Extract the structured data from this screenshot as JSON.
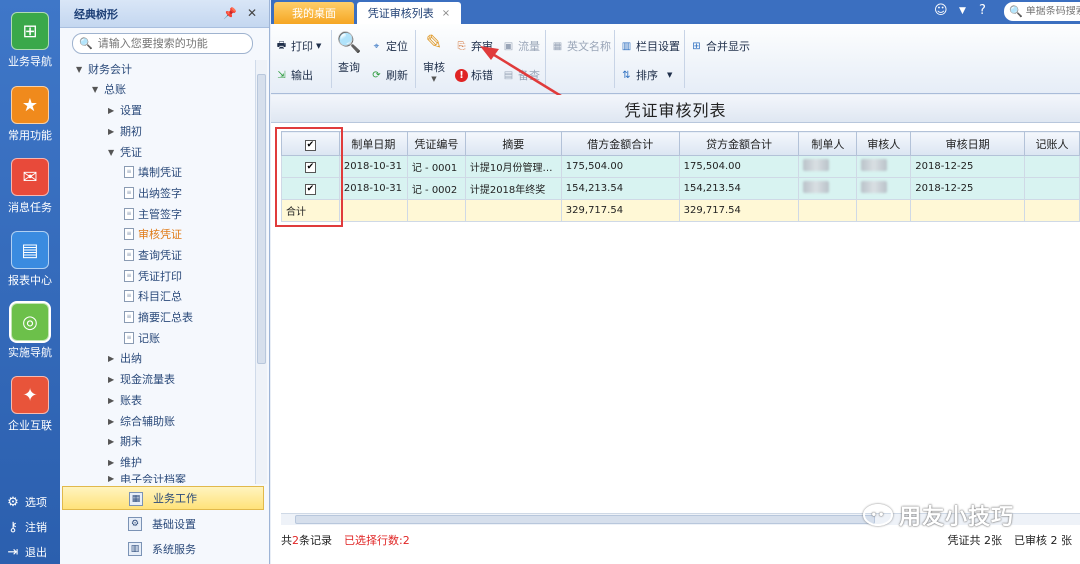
{
  "leftnav": {
    "items": [
      {
        "label": "业务导航",
        "color": "#3aa84a",
        "icon": "flowchart-icon"
      },
      {
        "label": "常用功能",
        "color": "#f08a1c",
        "icon": "star-icon"
      },
      {
        "label": "消息任务",
        "color": "#e84a3a",
        "icon": "envelope-icon"
      },
      {
        "label": "报表中心",
        "color": "#3a8be0",
        "icon": "report-icon"
      },
      {
        "label": "实施导航",
        "color": "#6cc04a",
        "icon": "compass-icon"
      },
      {
        "label": "企业互联",
        "color": "#e8543a",
        "icon": "connect-icon"
      }
    ],
    "bottom": [
      {
        "label": "选项",
        "icon": "gear-icon"
      },
      {
        "label": "注销",
        "icon": "key-icon"
      },
      {
        "label": "退出",
        "icon": "exit-icon"
      }
    ]
  },
  "tree": {
    "title": "经典树形",
    "search_placeholder": "请输入您要搜索的功能",
    "nodes": [
      {
        "label": "财务会计"
      },
      {
        "label": "总账"
      },
      {
        "label": "设置"
      },
      {
        "label": "期初"
      },
      {
        "label": "凭证"
      },
      {
        "label": "填制凭证"
      },
      {
        "label": "出纳签字"
      },
      {
        "label": "主管签字"
      },
      {
        "label": "审核凭证"
      },
      {
        "label": "查询凭证"
      },
      {
        "label": "凭证打印"
      },
      {
        "label": "科目汇总"
      },
      {
        "label": "摘要汇总表"
      },
      {
        "label": "记账"
      },
      {
        "label": "出纳"
      },
      {
        "label": "现金流量表"
      },
      {
        "label": "账表"
      },
      {
        "label": "综合辅助账"
      },
      {
        "label": "期末"
      },
      {
        "label": "维护"
      },
      {
        "label": "电子会计档案"
      }
    ],
    "panels": [
      {
        "label": "业务工作"
      },
      {
        "label": "基础设置"
      },
      {
        "label": "系统服务"
      }
    ]
  },
  "tabs": [
    {
      "label": "我的桌面"
    },
    {
      "label": "凭证审核列表",
      "close": "×"
    }
  ],
  "topbar": {
    "search_placeholder": "单据条码搜索"
  },
  "toolbar": {
    "print": "打印",
    "export": "输出",
    "query": "查询",
    "locate": "定位",
    "refresh": "刷新",
    "audit": "审核",
    "abandon": "弃审",
    "flow": "流量",
    "mark_error": "标错",
    "note": "备查",
    "english_name": "英文名称",
    "column_settings": "栏目设置",
    "sort": "排序",
    "merge_display": "合并显示"
  },
  "content": {
    "title": "凭证审核列表",
    "columns": [
      "✔",
      "制单日期",
      "凭证编号",
      "摘要",
      "借方金额合计",
      "贷方金额合计",
      "制单人",
      "审核人",
      "审核日期",
      "记账人"
    ],
    "rows": [
      {
        "check": "✔",
        "date": "2018-10-31",
        "voucher_no": "记 - 0001",
        "summary": "计提10月份管理…",
        "debit": "175,504.00",
        "credit": "175,504.00",
        "audit_date": "2018-12-25"
      },
      {
        "check": "✔",
        "date": "2018-10-31",
        "voucher_no": "记 - 0002",
        "summary": "计提2018年终奖",
        "debit": "154,213.54",
        "credit": "154,213.54",
        "audit_date": "2018-12-25"
      }
    ],
    "total": {
      "label": "合计",
      "debit": "329,717.54",
      "credit": "329,717.54"
    },
    "status": {
      "record_prefix": "共",
      "record_count": "2",
      "record_suffix": "条记录",
      "selected": "已选择行数:2",
      "voucher_total": "凭证共 2张",
      "audited": "已审核 2 张"
    },
    "watermark": "用友小技巧"
  },
  "colors": {
    "nav_bg": "#2b5fae",
    "row_bg": "#d8f3f1",
    "total_bg": "#fff8d6",
    "highlight_red": "#e03b3b",
    "active_tab": "#f5a623"
  }
}
